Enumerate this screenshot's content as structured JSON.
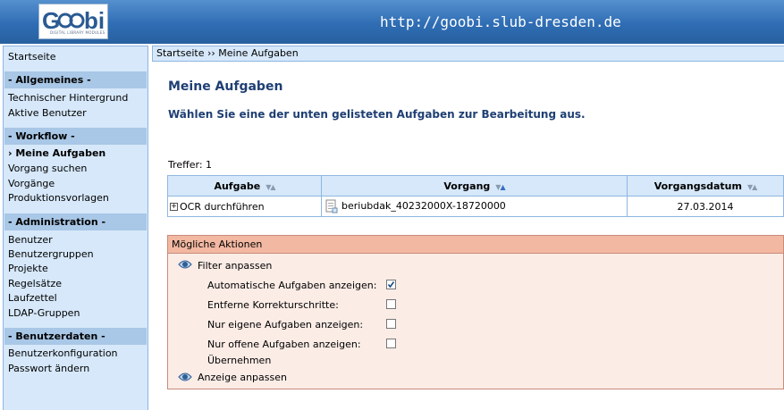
{
  "header": {
    "logo_text": "Goobi",
    "logo_subtext": "DIGITAL LIBRARY MODULES",
    "url": "http://goobi.slub-dresden.de"
  },
  "sidebar": {
    "start": "Startseite",
    "sections": {
      "allgemeines": "- Allgemeines -",
      "workflow": "- Workflow -",
      "administration": "- Administration -",
      "benutzerdaten": "- Benutzerdaten -"
    },
    "allgemeines_items": [
      "Technischer Hintergrund",
      "Aktive Benutzer"
    ],
    "workflow_items": [
      "› Meine Aufgaben",
      "Vorgang suchen",
      "Vorgänge",
      "Produktionsvorlagen"
    ],
    "administration_items": [
      "Benutzer",
      "Benutzergruppen",
      "Projekte",
      "Regelsätze",
      "Laufzettel",
      "LDAP-Gruppen"
    ],
    "benutzerdaten_items": [
      "Benutzerkonfiguration",
      "Passwort ändern"
    ]
  },
  "breadcrumb": "Startseite ›› Meine Aufgaben",
  "main": {
    "title": "Meine Aufgaben",
    "subtitle": "Wählen Sie eine der unten gelisteten Aufgaben zur Bearbeitung aus.",
    "hits": "Treffer: 1"
  },
  "table": {
    "columns": [
      "Aufgabe",
      "Vorgang",
      "Vorgangsdatum"
    ],
    "rows": [
      {
        "aufgabe": "OCR durchführen",
        "vorgang": "beriubdak_40232000X-18720000",
        "datum": "27.03.2014"
      }
    ]
  },
  "actions": {
    "header": "Mögliche Aktionen",
    "filter_label": "Filter anpassen",
    "options": [
      {
        "label": "Automatische Aufgaben anzeigen:",
        "checked": true
      },
      {
        "label": "Entferne Korrekturschritte:",
        "checked": false
      },
      {
        "label": "Nur eigene Aufgaben anzeigen:",
        "checked": false
      },
      {
        "label": "Nur offene Aufgaben anzeigen:",
        "checked": false
      }
    ],
    "apply_label": "Übernehmen",
    "display_label": "Anzeige anpassen"
  },
  "colors": {
    "header_blue": "#2f6db4",
    "sidebar_bg": "#d6e8fa",
    "section_bg": "#a9c7e6",
    "title_color": "#1f3f73",
    "actions_bg": "#fbece6",
    "actions_header": "#f2b8a2"
  }
}
